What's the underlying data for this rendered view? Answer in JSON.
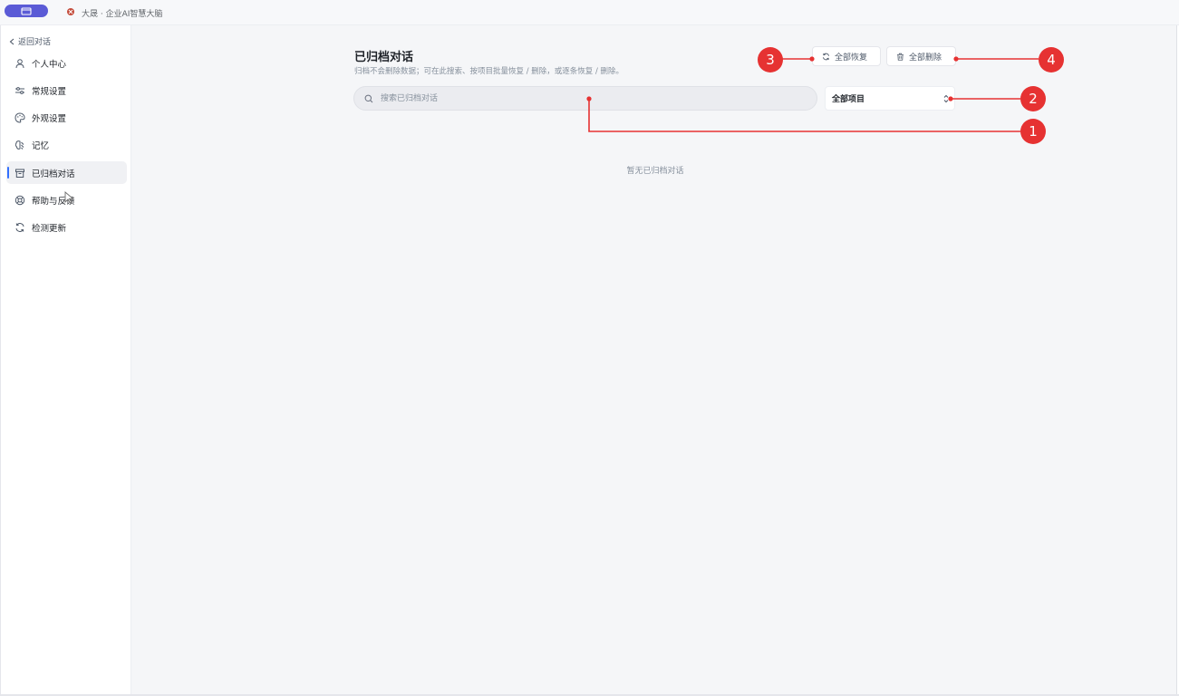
{
  "window": {
    "tab_title": "大晟 · 企业AI智慧大脑"
  },
  "sidebar": {
    "back_label": "返回对话",
    "items": [
      {
        "label": "个人中心",
        "icon": "user-icon"
      },
      {
        "label": "常规设置",
        "icon": "sliders-icon"
      },
      {
        "label": "外观设置",
        "icon": "palette-icon"
      },
      {
        "label": "记忆",
        "icon": "brain-icon"
      },
      {
        "label": "已归档对话",
        "icon": "archive-icon",
        "active": true
      },
      {
        "label": "帮助与反馈",
        "icon": "lifebuoy-icon"
      },
      {
        "label": "检测更新",
        "icon": "refresh-icon"
      }
    ]
  },
  "main": {
    "title": "已归档对话",
    "subtitle": "归档不会删除数据；可在此搜索、按项目批量恢复 / 删除，或逐条恢复 / 删除。",
    "restore_all_label": "全部恢复",
    "delete_all_label": "全部删除",
    "search_placeholder": "搜索已归档对话",
    "project_select_value": "全部项目",
    "empty_text": "暂无已归档对话"
  },
  "annotations": [
    "1",
    "2",
    "3",
    "4"
  ],
  "colors": {
    "accent": "#5b5bd6",
    "active_indicator": "#3370ff",
    "annotation_red": "#e63232"
  }
}
